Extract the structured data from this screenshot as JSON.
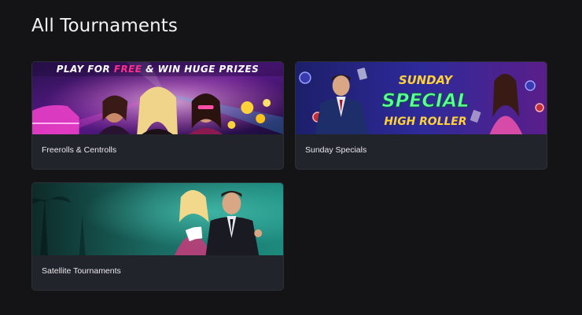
{
  "page": {
    "title": "All Tournaments"
  },
  "cards": [
    {
      "label": "Freerolls & Centrolls",
      "banner": {
        "text_before": "PLAY FOR ",
        "text_highlight": "FREE",
        "text_after": " & WIN HUGE PRIZES"
      }
    },
    {
      "label": "Sunday Specials",
      "banner": {
        "line1": "SUNDAY",
        "line2": "SPECIAL",
        "line3": "HIGH ROLLER"
      }
    },
    {
      "label": "Satellite Tournaments"
    }
  ],
  "colors": {
    "background": "#141417",
    "card": "#22242b",
    "highlight_pink": "#ff2e8a",
    "special_green": "#5dff9a",
    "gold": "#ffd23a"
  }
}
